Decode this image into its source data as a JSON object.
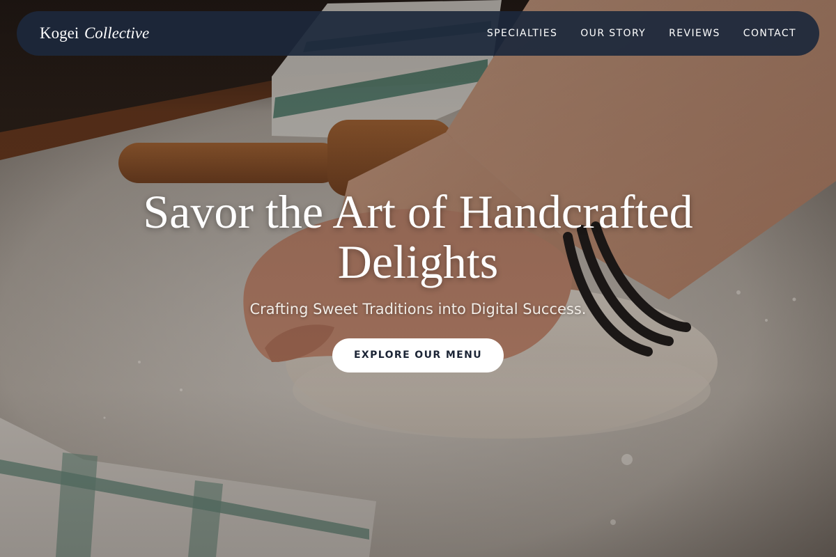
{
  "brand": {
    "name": "Kogei",
    "name_italic": "Collective"
  },
  "nav": {
    "items": [
      {
        "label": "SPECIALTIES"
      },
      {
        "label": "OUR STORY"
      },
      {
        "label": "REVIEWS"
      },
      {
        "label": "CONTACT"
      }
    ]
  },
  "hero": {
    "headline": "Savor the Art of Handcrafted Delights",
    "subheadline": "Crafting Sweet Traditions into Digital Success.",
    "cta_label": "EXPLORE OUR MENU",
    "image_subject": "hands kneading dough on floured board"
  },
  "colors": {
    "navbar_bg": "#1c283c",
    "text_light": "#ffffff",
    "cta_bg": "#ffffff",
    "cta_text": "#1c2536"
  }
}
